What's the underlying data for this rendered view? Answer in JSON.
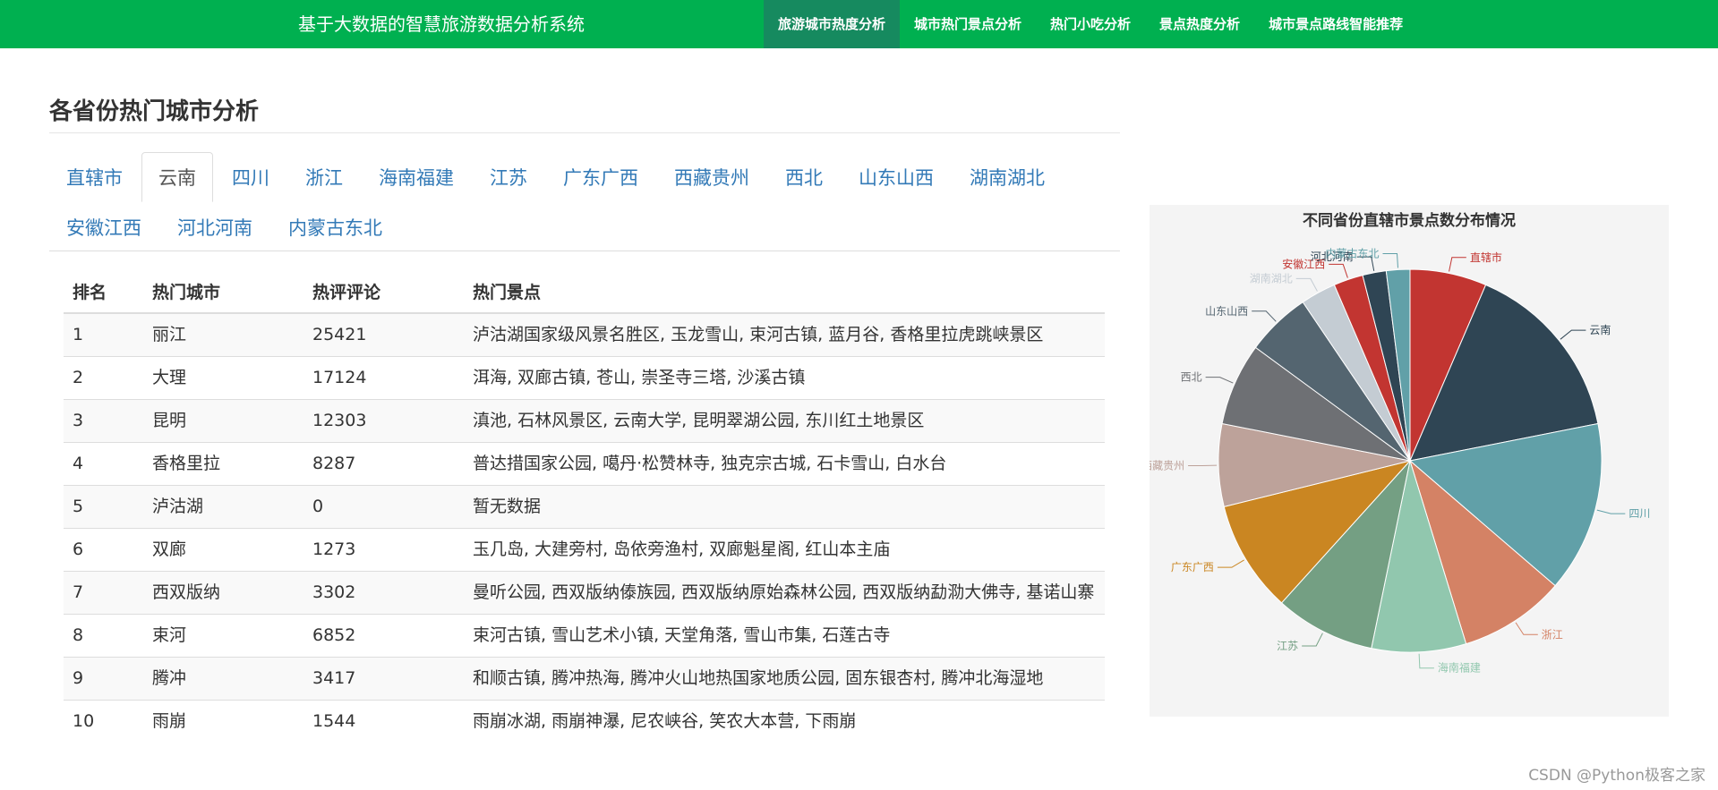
{
  "navbar": {
    "brand": "基于大数据的智慧旅游数据分析系统",
    "items": [
      {
        "label": "旅游城市热度分析",
        "active": true
      },
      {
        "label": "城市热门景点分析",
        "active": false
      },
      {
        "label": "热门小吃分析",
        "active": false
      },
      {
        "label": "景点热度分析",
        "active": false
      },
      {
        "label": "城市景点路线智能推荐",
        "active": false
      }
    ]
  },
  "section": {
    "title": "各省份热门城市分析"
  },
  "tabs": [
    {
      "label": "直辖市",
      "active": false
    },
    {
      "label": "云南",
      "active": true
    },
    {
      "label": "四川",
      "active": false
    },
    {
      "label": "浙江",
      "active": false
    },
    {
      "label": "海南福建",
      "active": false
    },
    {
      "label": "江苏",
      "active": false
    },
    {
      "label": "广东广西",
      "active": false
    },
    {
      "label": "西藏贵州",
      "active": false
    },
    {
      "label": "西北",
      "active": false
    },
    {
      "label": "山东山西",
      "active": false
    },
    {
      "label": "湖南湖北",
      "active": false
    },
    {
      "label": "安徽江西",
      "active": false
    },
    {
      "label": "河北河南",
      "active": false
    },
    {
      "label": "内蒙古东北",
      "active": false
    }
  ],
  "table": {
    "headers": [
      "排名",
      "热门城市",
      "热评评论",
      "热门景点"
    ],
    "rows": [
      [
        "1",
        "丽江",
        "25421",
        "泸沽湖国家级风景名胜区, 玉龙雪山, 束河古镇, 蓝月谷, 香格里拉虎跳峡景区"
      ],
      [
        "2",
        "大理",
        "17124",
        "洱海, 双廊古镇, 苍山, 崇圣寺三塔, 沙溪古镇"
      ],
      [
        "3",
        "昆明",
        "12303",
        "滇池, 石林风景区, 云南大学, 昆明翠湖公园, 东川红土地景区"
      ],
      [
        "4",
        "香格里拉",
        "8287",
        "普达措国家公园, 噶丹·松赞林寺, 独克宗古城, 石卡雪山, 白水台"
      ],
      [
        "5",
        "泸沽湖",
        "0",
        "暂无数据"
      ],
      [
        "6",
        "双廊",
        "1273",
        "玉几岛, 大建旁村, 岛依旁渔村, 双廊魁星阁, 红山本主庙"
      ],
      [
        "7",
        "西双版纳",
        "3302",
        "曼听公园, 西双版纳傣族园, 西双版纳原始森林公园, 西双版纳勐泐大佛寺, 基诺山寨"
      ],
      [
        "8",
        "束河",
        "6852",
        "束河古镇, 雪山艺术小镇, 天堂角落, 雪山市集, 石莲古寺"
      ],
      [
        "9",
        "腾冲",
        "3417",
        "和顺古镇, 腾冲热海, 腾冲火山地热国家地质公园, 固东银杏村, 腾冲北海湿地"
      ],
      [
        "10",
        "雨崩",
        "1544",
        "雨崩冰湖, 雨崩神瀑, 尼农峡谷, 笑农大本营, 下雨崩"
      ]
    ]
  },
  "chart_data": {
    "type": "pie",
    "title": "不同省份直辖市景点数分布情况",
    "series": [
      {
        "name": "直辖市",
        "value": 6.5,
        "color": "#c23531"
      },
      {
        "name": "云南",
        "value": 15.5,
        "color": "#2f4554"
      },
      {
        "name": "四川",
        "value": 14.5,
        "color": "#61a0a8"
      },
      {
        "name": "浙江",
        "value": 9.0,
        "color": "#d48265"
      },
      {
        "name": "海南福建",
        "value": 8.0,
        "color": "#91c7ae"
      },
      {
        "name": "江苏",
        "value": 8.5,
        "color": "#749f83"
      },
      {
        "name": "广东广西",
        "value": 9.5,
        "color": "#ca8622"
      },
      {
        "name": "西藏贵州",
        "value": 7.0,
        "color": "#bda29a"
      },
      {
        "name": "西北",
        "value": 7.0,
        "color": "#6e7074"
      },
      {
        "name": "山东山西",
        "value": 5.5,
        "color": "#546570"
      },
      {
        "name": "湖南湖北",
        "value": 3.0,
        "color": "#c4ccd3"
      },
      {
        "name": "安徽江西",
        "value": 2.5,
        "color": "#c23531"
      },
      {
        "name": "河北河南",
        "value": 2.0,
        "color": "#2f4554"
      },
      {
        "name": "内蒙古东北",
        "value": 2.0,
        "color": "#61a0a8"
      }
    ]
  },
  "watermark": "CSDN @Python极客之家"
}
